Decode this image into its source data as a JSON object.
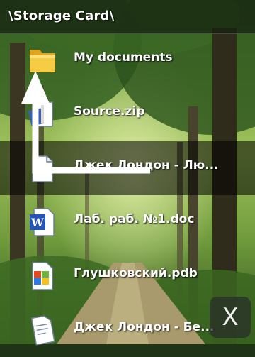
{
  "header": {
    "title": "\\Storage Card\\"
  },
  "files": [
    {
      "label": "My documents",
      "icon": "folder-icon"
    },
    {
      "label": "Source.zip",
      "icon": "zip-archive-icon"
    },
    {
      "label": "Джек Лондон - Лю...",
      "icon": "text-document-icon",
      "selected": true
    },
    {
      "label": "Лаб. раб. №1.doc",
      "icon": "word-document-icon"
    },
    {
      "label": "Глушковский.pdb",
      "icon": "windows-file-icon"
    },
    {
      "label": "Джек Лондон - Бе...",
      "icon": "text-document-icon"
    }
  ],
  "close_button": {
    "label": "X"
  },
  "colors": {
    "selected_row": "#000000",
    "text": "#ffffff",
    "folder": "#f2c230"
  }
}
